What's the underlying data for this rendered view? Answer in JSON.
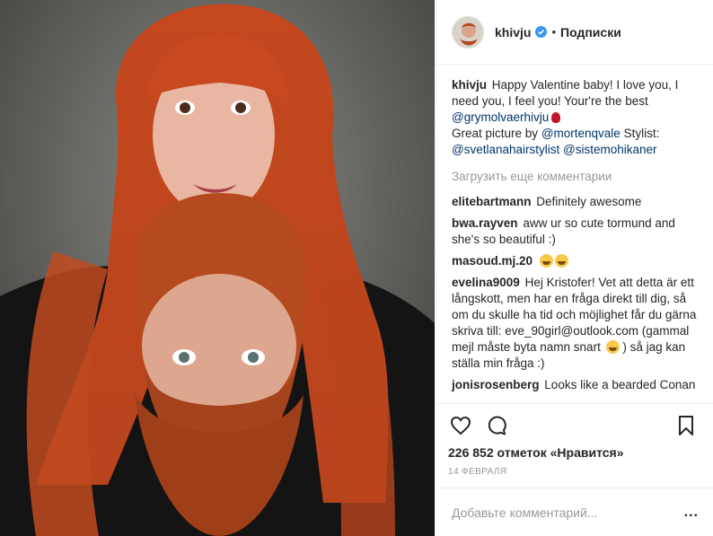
{
  "post": {
    "username": "khivju",
    "follow_label": "Подписки",
    "separator": "•"
  },
  "caption": {
    "username": "khivju",
    "text1": "Happy Valentine baby! I love you, I need you, I feel you! Your're the best",
    "mention1": "@grymolvaerhivju",
    "text2": "Great picture by",
    "mention2": "@mortenqvale",
    "text3": "Stylist:",
    "mention3": "@svetlanahairstylist",
    "mention4": "@sistemohikaner"
  },
  "load_more_label": "Загрузить еще комментарии",
  "comments": [
    {
      "user": "elitebartmann",
      "text": "Definitely awesome"
    },
    {
      "user": "bwa.rayven",
      "text": "aww ur so cute tormund and she's so beautiful :)"
    },
    {
      "user": "masoud.mj.20",
      "text": ""
    },
    {
      "user": "evelina9009",
      "text": "Hej Kristofer! Vet att detta är ett långskott, men har en fråga direkt till dig, så om du skulle ha tid och möjlighet får du gärna skriva till: eve_90girl@outlook.com (gammal mejl måste byta namn snart",
      "text_after": ") så jag kan ställa min fråga :)"
    },
    {
      "user": "jonisrosenberg",
      "text": "Looks like a bearded Conan"
    }
  ],
  "likes_label": "226 852 отметок «Нравится»",
  "date_label": "14 ФЕВРАЛЯ",
  "add_comment_placeholder": "Добавьте комментарий...",
  "more_label": "...",
  "icons": {
    "like": "heart-icon",
    "comment": "comment-icon",
    "save": "bookmark-icon",
    "verified": "verified-badge-icon"
  },
  "colors": {
    "mention": "#003569",
    "muted": "#999999",
    "verified": "#3897f0",
    "border": "#efefef"
  }
}
